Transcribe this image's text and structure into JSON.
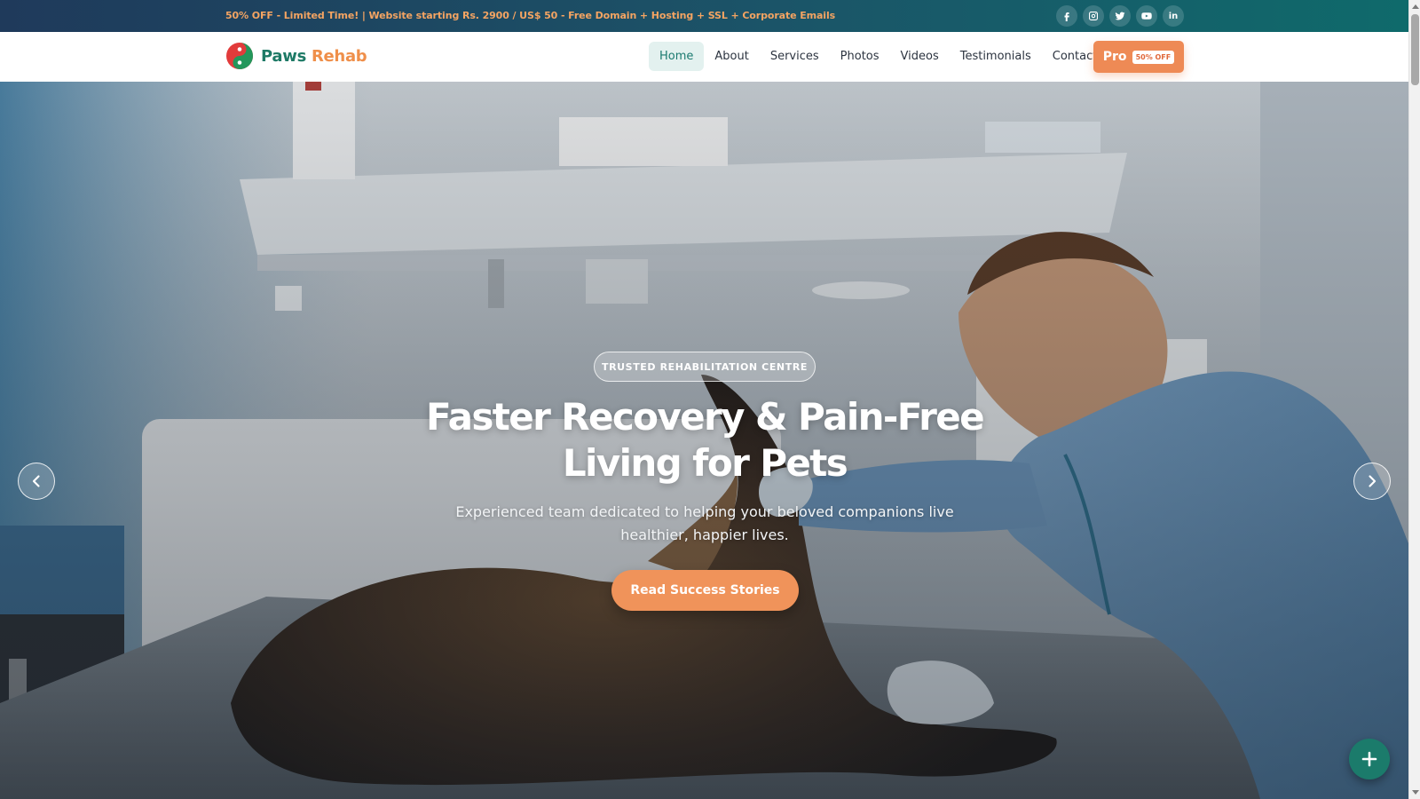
{
  "promo": {
    "text": "50% OFF - Limited Time! | Website starting Rs. 2900 / US$ 50 - Free Domain + Hosting + SSL + Corporate Emails"
  },
  "socials": [
    {
      "icon": "facebook-icon"
    },
    {
      "icon": "instagram-icon"
    },
    {
      "icon": "twitter-icon"
    },
    {
      "icon": "youtube-icon"
    },
    {
      "icon": "linkedin-icon",
      "text": "in"
    }
  ],
  "brand": {
    "name_part1": "Paws",
    "name_part2": "Rehab",
    "primary_color": "#1e7a66",
    "accent_color": "#ef8f4a"
  },
  "nav": {
    "items": [
      {
        "label": "Home",
        "active": true
      },
      {
        "label": "About"
      },
      {
        "label": "Services"
      },
      {
        "label": "Photos"
      },
      {
        "label": "Videos"
      },
      {
        "label": "Testimonials"
      },
      {
        "label": "Contact"
      }
    ],
    "pro_label": "Pro",
    "pro_badge": "50% OFF"
  },
  "hero": {
    "badge": "TRUSTED REHABILITATION CENTRE",
    "headline_line1": "Faster Recovery & Pain-Free",
    "headline_line2": "Living for Pets",
    "subtitle": "Experienced team dedicated to helping your beloved companions live healthier, happier lives.",
    "cta_label": "Read Success Stories"
  }
}
